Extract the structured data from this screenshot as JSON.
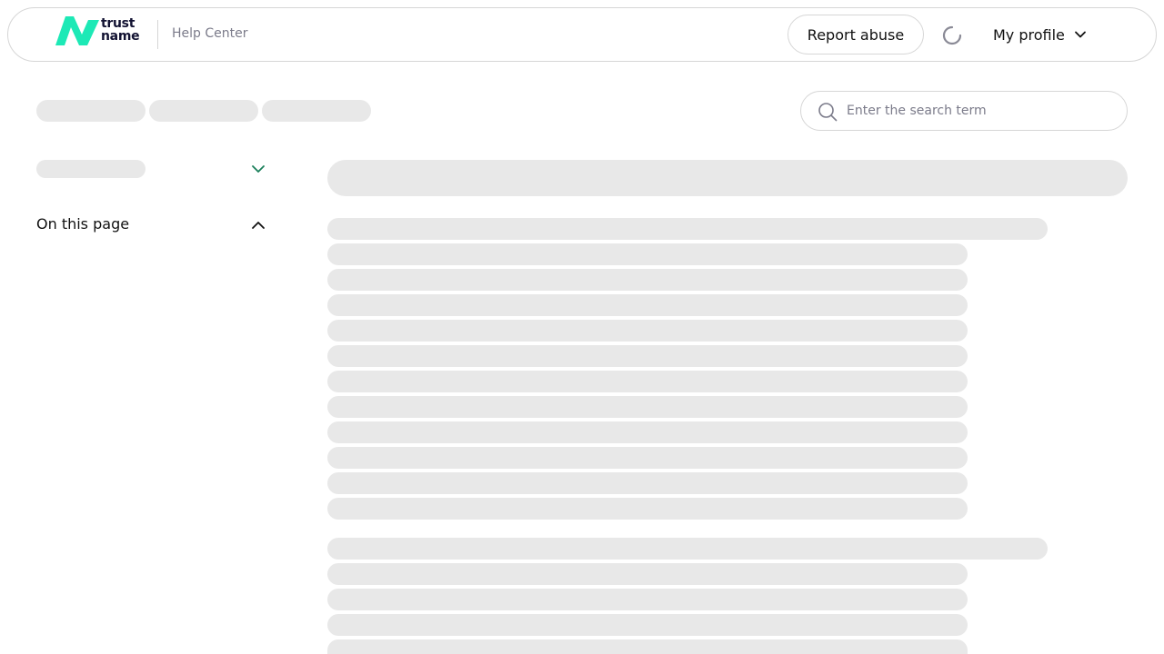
{
  "header": {
    "logo": {
      "line1": "trust",
      "line2": "name",
      "mark_color": "#1de9b6",
      "text_color": "#121232"
    },
    "help_center": "Help Center",
    "report_abuse": "Report abuse",
    "loading_icon": "spinner-icon",
    "profile_label": "My profile",
    "profile_icon": "chevron-down-icon"
  },
  "search": {
    "placeholder": "Enter the search term",
    "icon": "search-icon"
  },
  "sidebar": {
    "section_toggle_icon": "chevron-down-icon",
    "on_this_page": "On this page",
    "on_this_page_icon": "chevron-up-icon"
  },
  "colors": {
    "skeleton": "#e8e8e8",
    "border": "#d6d6d6",
    "accent": "#1a7f5a",
    "muted_text": "#7b7b8a"
  }
}
